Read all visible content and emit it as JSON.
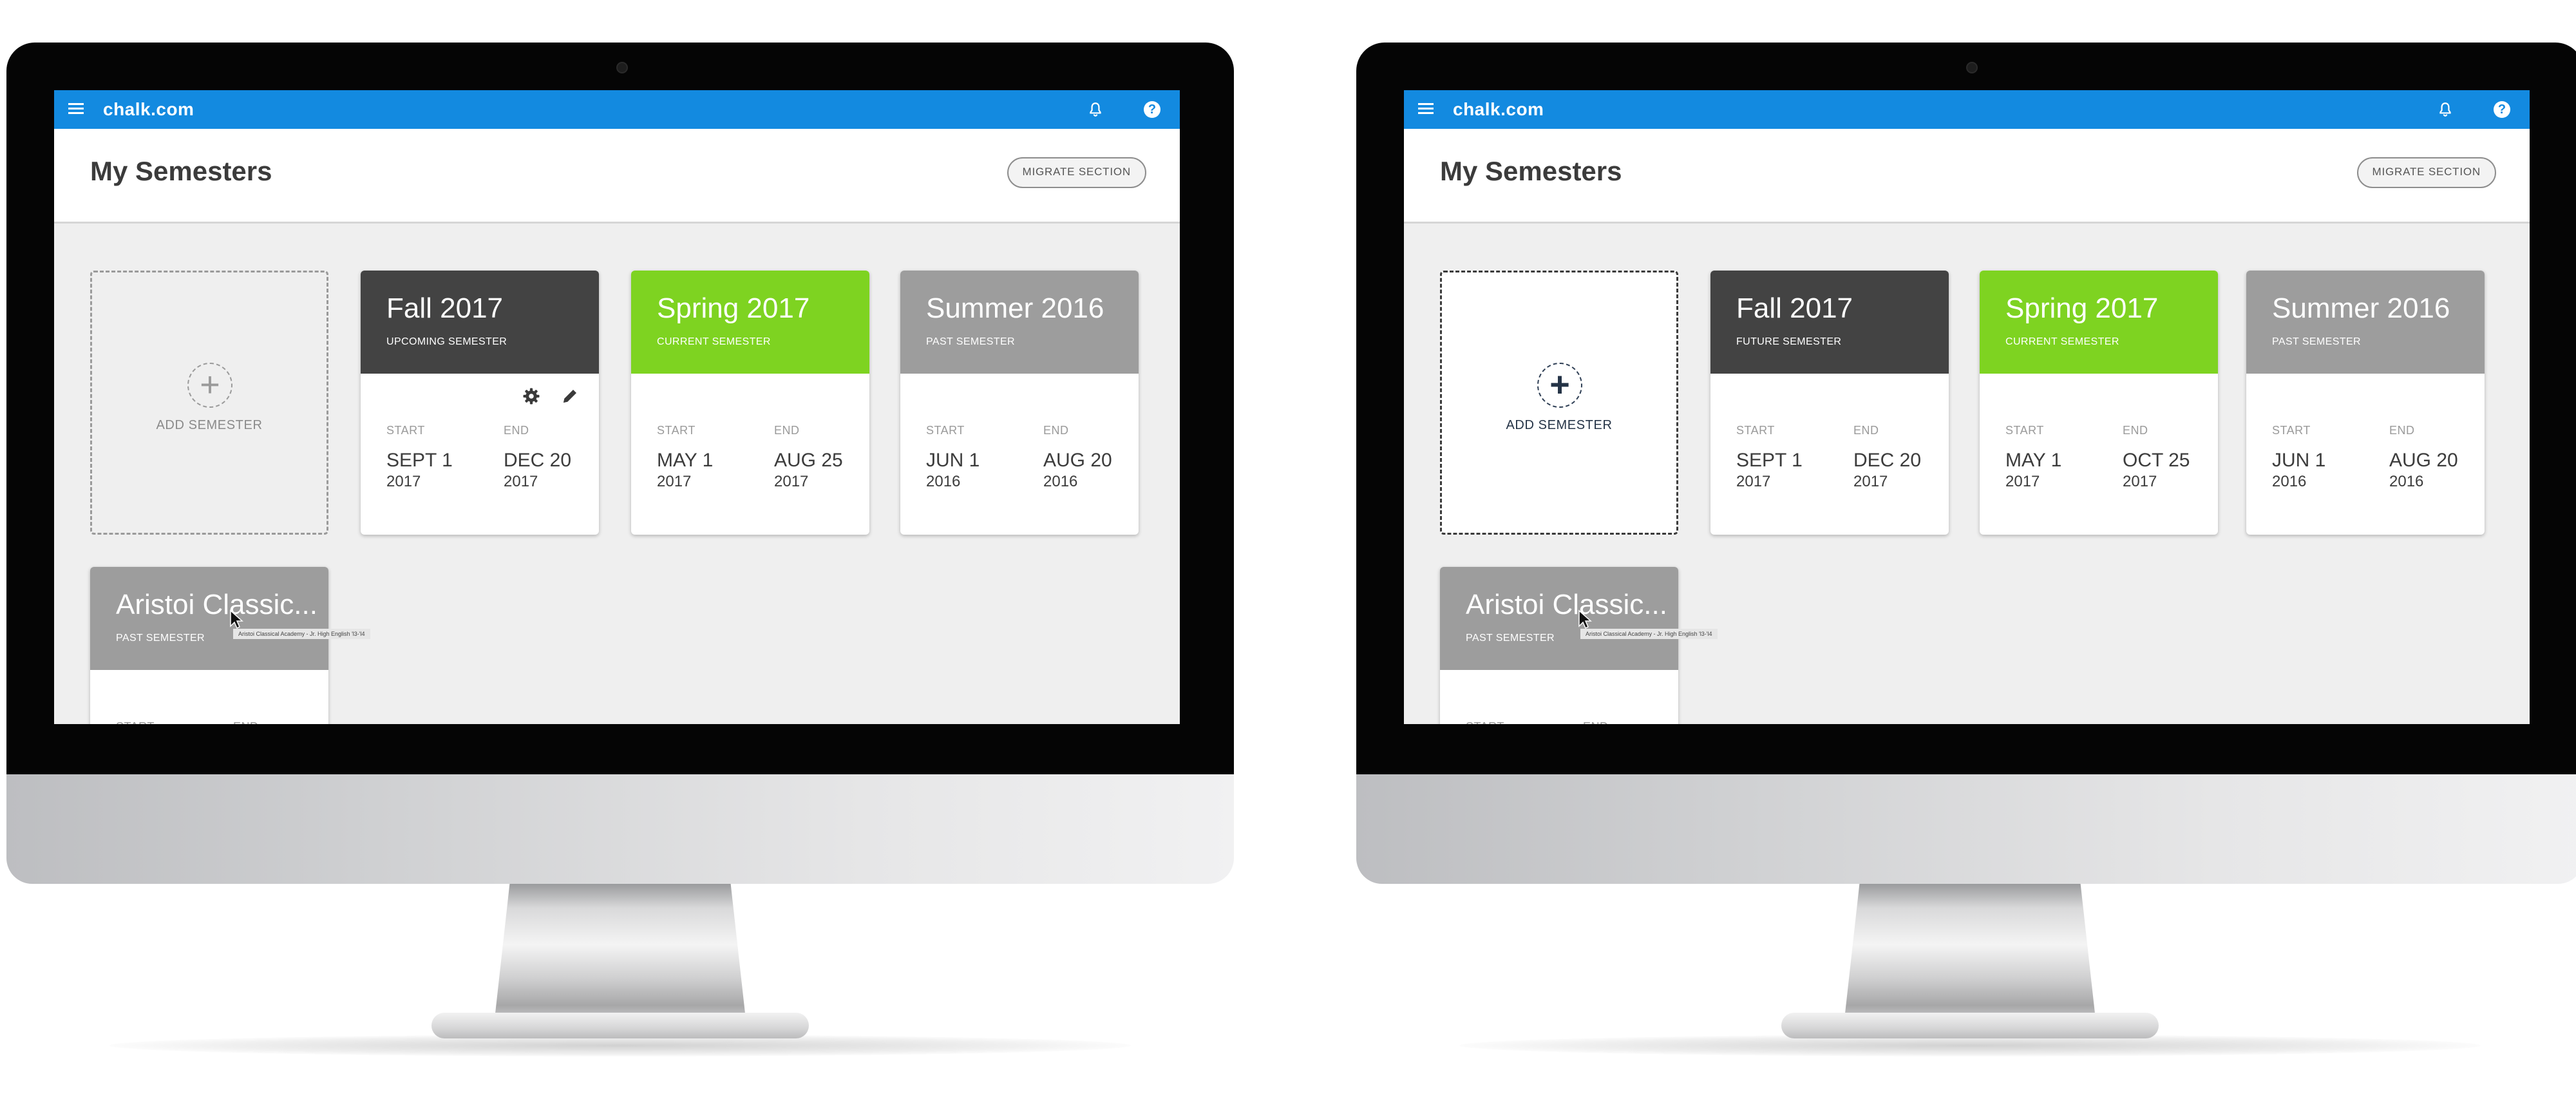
{
  "app": {
    "brand": "chalk.com",
    "page_title": "My Semesters",
    "migrate_label": "MIGRATE SECTION"
  },
  "colors": {
    "topbar": "#138ae0",
    "dark_header": "#434343",
    "current_header": "#7ed321",
    "past_header": "#9d9d9d"
  },
  "icons": [
    "menu-icon",
    "bell-icon",
    "help-icon",
    "plus-icon",
    "gear-icon",
    "pencil-icon",
    "cursor-icon"
  ],
  "labels": {
    "start": "START",
    "end": "END"
  },
  "screens": [
    {
      "add_label": "ADD SEMESTER",
      "cards": [
        {
          "name": "Fall 2017",
          "status": "UPCOMING SEMESTER",
          "start_date": "SEPT 1",
          "start_year": "2017",
          "end_date": "DEC 20",
          "end_year": "2017"
        },
        {
          "name": "Spring 2017",
          "status": "CURRENT SEMESTER",
          "start_date": "MAY 1",
          "start_year": "2017",
          "end_date": "AUG 25",
          "end_year": "2017"
        },
        {
          "name": "Summer 2016",
          "status": "PAST SEMESTER",
          "start_date": "JUN 1",
          "start_year": "2016",
          "end_date": "AUG 20",
          "end_year": "2016"
        },
        {
          "name": "Aristoi Classic...",
          "status": "PAST SEMESTER",
          "start_date": "",
          "start_year": "",
          "end_date": "",
          "end_year": ""
        }
      ],
      "tooltip": "Aristoi Classical Academy - Jr. High English 'l3-'l4"
    },
    {
      "add_label": "ADD SEMESTER",
      "cards": [
        {
          "name": "Fall 2017",
          "status": "FUTURE SEMESTER",
          "start_date": "SEPT 1",
          "start_year": "2017",
          "end_date": "DEC 20",
          "end_year": "2017"
        },
        {
          "name": "Spring 2017",
          "status": "CURRENT SEMESTER",
          "start_date": "MAY 1",
          "start_year": "2017",
          "end_date": "OCT 25",
          "end_year": "2017"
        },
        {
          "name": "Summer 2016",
          "status": "PAST SEMESTER",
          "start_date": "JUN 1",
          "start_year": "2016",
          "end_date": "AUG 20",
          "end_year": "2016"
        },
        {
          "name": "Aristoi Classic...",
          "status": "PAST SEMESTER",
          "start_date": "",
          "start_year": "",
          "end_date": "",
          "end_year": ""
        }
      ],
      "tooltip": "Aristoi Classical Academy - Jr. High English 'l3-'l4"
    }
  ]
}
